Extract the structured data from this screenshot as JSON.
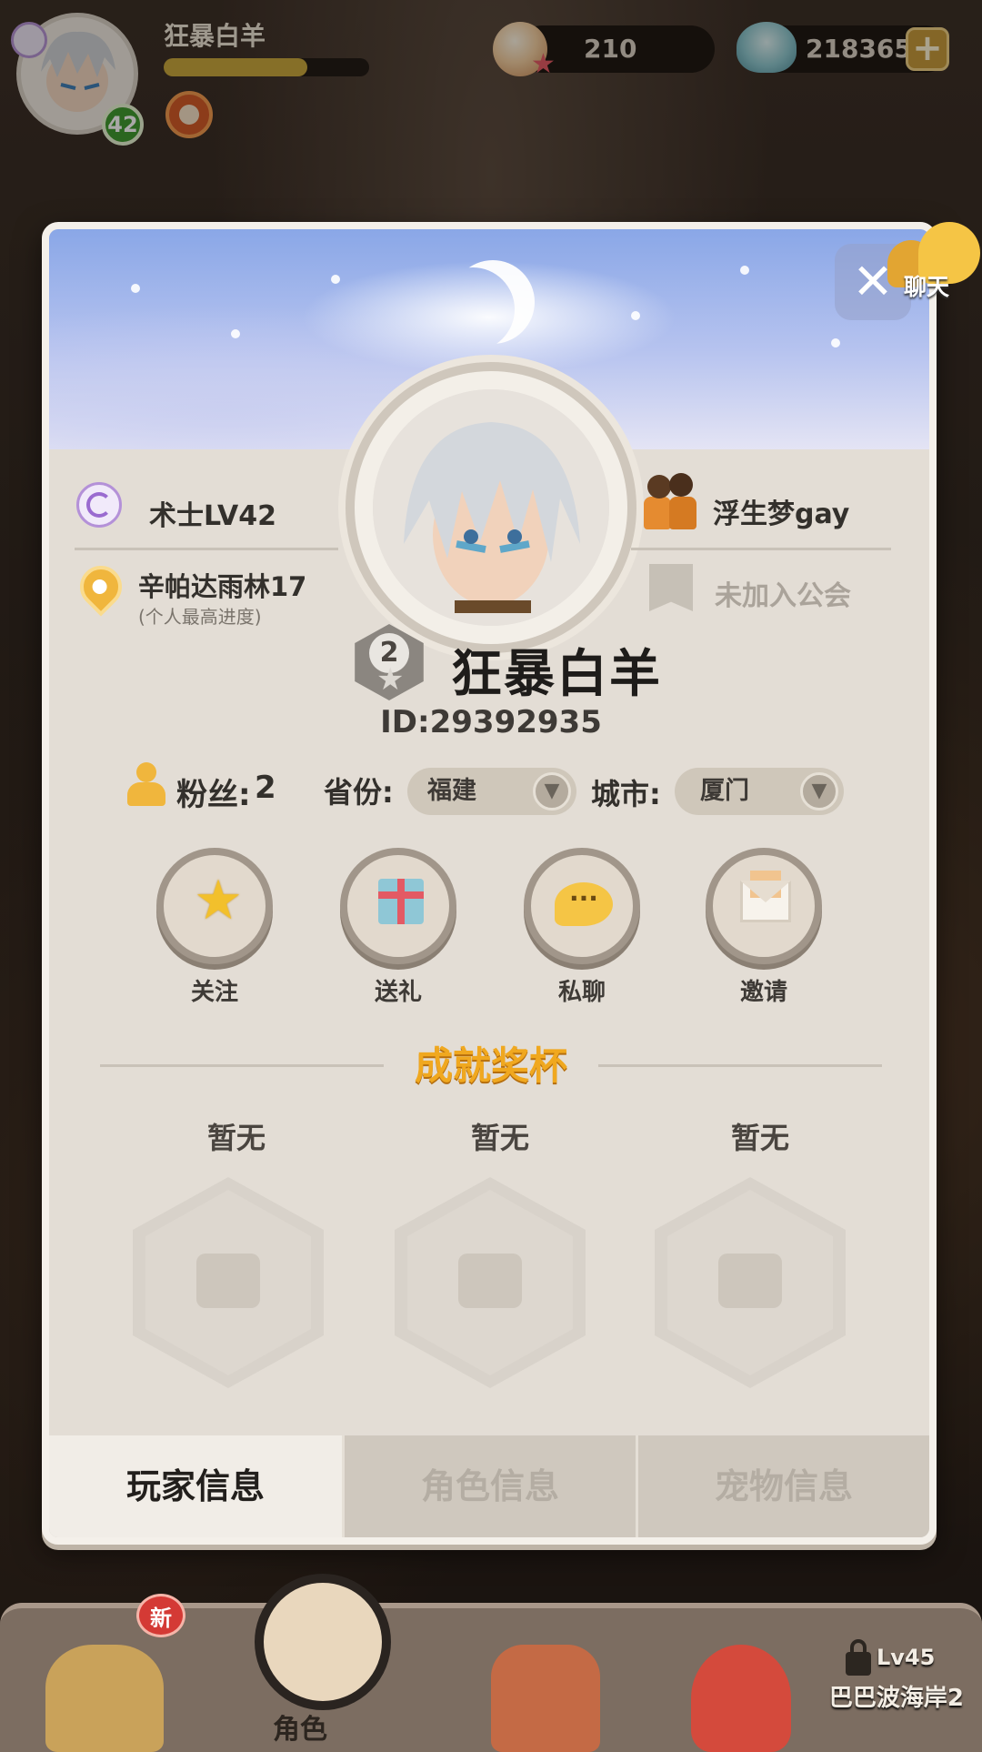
{
  "hud": {
    "player_name": "狂暴白羊",
    "level": "42",
    "xp_fraction": 0.7,
    "pearls": "210",
    "shells": "218365",
    "plus_symbol": "+"
  },
  "profile": {
    "close_symbol": "✕",
    "chat_label": "聊天",
    "class_text": "术士LV42",
    "location": "辛帕达雨林17",
    "location_note": "(个人最高进度)",
    "partner": "浮生梦gay",
    "guild": "未加入公会",
    "rank": "2",
    "name": "狂暴白羊",
    "id": "ID:29392935",
    "fans_label": "粉丝:",
    "fans_count": "2",
    "province_label": "省份:",
    "province_value": "福建",
    "city_label": "城市:",
    "city_value": "厦门",
    "actions": [
      {
        "label": "关注",
        "icon": "star-icon"
      },
      {
        "label": "送礼",
        "icon": "gift-icon"
      },
      {
        "label": "私聊",
        "icon": "chat-icon"
      },
      {
        "label": "邀请",
        "icon": "mail-icon"
      }
    ],
    "achievements_title": "成就奖杯",
    "trophies": [
      "暂无",
      "暂无",
      "暂无"
    ],
    "tabs": [
      "玩家信息",
      "角色信息",
      "宠物信息"
    ],
    "active_tab": 0
  },
  "bottom_nav": {
    "new_badge": "新",
    "role_label": "角色",
    "locked_level": "Lv45",
    "locked_place": "巴巴波海岸2"
  },
  "colors": {
    "accent_gold": "#f0a81f",
    "panel_bg": "#e3ddd5",
    "level_green": "#3e9a2e"
  }
}
